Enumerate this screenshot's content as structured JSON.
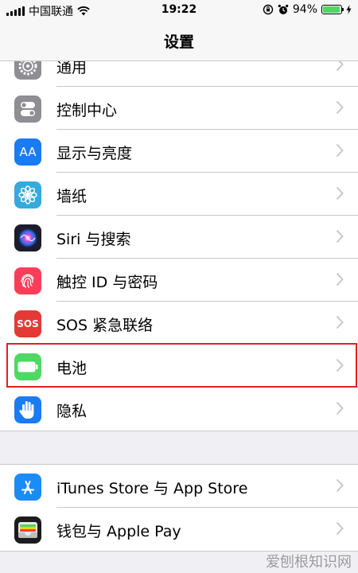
{
  "status_bar": {
    "carrier": "中国联通",
    "time": "19:22",
    "battery_percent": "94%",
    "battery_level": 0.94
  },
  "nav": {
    "title": "设置"
  },
  "colors": {
    "general": "#8e8e93",
    "control_center": "#8e8e93",
    "display": "#1a7cf5",
    "wallpaper": "#35aadc",
    "siri": "#1c1c2e",
    "touch_id": "#fc3d5a",
    "sos": "#e53935",
    "battery": "#4cd964",
    "privacy": "#1a7cf5",
    "app_store": "#1a8cf7",
    "wallet": "#1c1c1e",
    "highlight": "#e02020"
  },
  "group1": [
    {
      "label": "通用",
      "icon": "gear-icon"
    },
    {
      "label": "控制中心",
      "icon": "toggles-icon"
    },
    {
      "label": "显示与亮度",
      "icon": "text-size-icon",
      "icon_text": "AA"
    },
    {
      "label": "墙纸",
      "icon": "flower-icon"
    },
    {
      "label": "Siri 与搜索",
      "icon": "siri-icon"
    },
    {
      "label": "触控 ID 与密码",
      "icon": "fingerprint-icon"
    },
    {
      "label": "SOS 紧急联络",
      "icon": "sos-icon",
      "icon_text": "SOS"
    },
    {
      "label": "电池",
      "icon": "battery-icon"
    },
    {
      "label": "隐私",
      "icon": "hand-icon"
    }
  ],
  "group2": [
    {
      "label": "iTunes Store 与 App Store",
      "icon": "app-store-icon"
    },
    {
      "label": "钱包与 Apple Pay",
      "icon": "wallet-icon"
    }
  ],
  "watermark": "爱刨根知识网"
}
